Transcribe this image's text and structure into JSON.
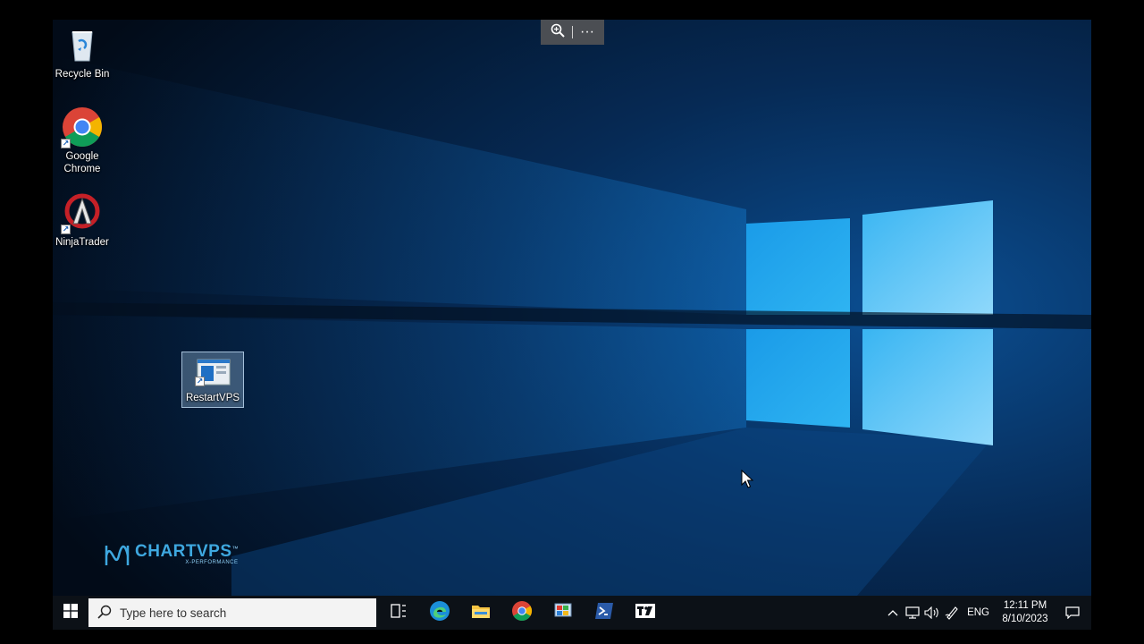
{
  "desktop": {
    "icons": [
      {
        "label": "Recycle Bin"
      },
      {
        "label": "Google Chrome"
      },
      {
        "label": "NinjaTrader"
      },
      {
        "label": "RestartVPS"
      }
    ]
  },
  "remote_bar": {
    "zoom_icon": "magnifier-icon",
    "more_label": "···"
  },
  "brand": {
    "name": "CHARTVPS",
    "trademark": "™",
    "tagline": "X-PERFORMANCE"
  },
  "taskbar": {
    "search_placeholder": "Type here to search",
    "pinned_apps": [
      "edge",
      "file-explorer",
      "chrome",
      "control-panel",
      "powershell",
      "tradingview"
    ],
    "language": "ENG",
    "time": "12:11 PM",
    "date": "8/10/2023"
  },
  "colors": {
    "taskbar_bg": "#0c1117",
    "accent": "#0078d7",
    "wallpaper_dark": "#04101f"
  }
}
